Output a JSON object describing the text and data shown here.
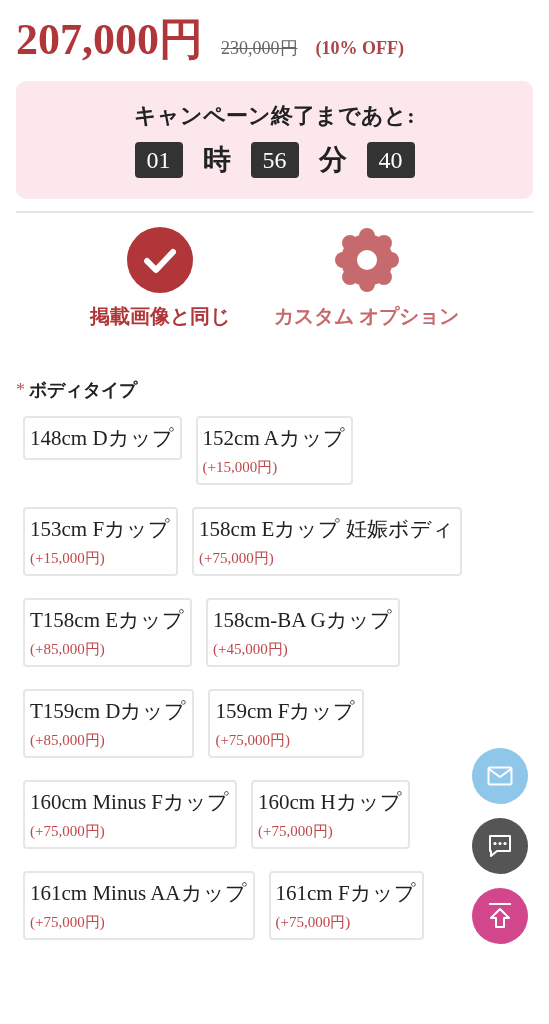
{
  "price": {
    "current": "207,000円",
    "original": "230,000円",
    "discount": "(10% OFF)"
  },
  "countdown": {
    "title": "キャンペーン終了まであと:",
    "segments": [
      {
        "kind": "number",
        "text": "01"
      },
      {
        "kind": "unit",
        "text": "時"
      },
      {
        "kind": "number",
        "text": "56"
      },
      {
        "kind": "unit",
        "text": "分"
      },
      {
        "kind": "number",
        "text": "40"
      }
    ]
  },
  "modes": [
    {
      "kind": "check",
      "label": "掲載画像と同じ",
      "selected": true
    },
    {
      "kind": "gear",
      "label": "カスタム オプション",
      "selected": false
    }
  ],
  "body_type": {
    "required_mark": "*",
    "title": "ボディタイプ",
    "options": [
      {
        "label": "148cm Dカップ"
      },
      {
        "label": "152cm Aカップ",
        "price": "(+15,000円)"
      },
      {
        "label": "153cm Fカップ",
        "price": "(+15,000円)"
      },
      {
        "label": "158cm Eカップ 妊娠ボディ",
        "price": "(+75,000円)"
      },
      {
        "label": "T158cm Eカップ",
        "price": "(+85,000円)"
      },
      {
        "label": "158cm-BA Gカップ",
        "price": "(+45,000円)"
      },
      {
        "label": "T159cm Dカップ",
        "price": "(+85,000円)"
      },
      {
        "label": "159cm Fカップ",
        "price": "(+75,000円)"
      },
      {
        "label": "160cm Minus Fカップ",
        "price": "(+75,000円)"
      },
      {
        "label": "160cm Hカップ",
        "price": "(+75,000円)"
      },
      {
        "label": "161cm Minus AAカップ",
        "price": "(+75,000円)"
      },
      {
        "label": "161cm Fカップ",
        "price": "(+75,000円)"
      }
    ]
  },
  "floating_buttons": [
    {
      "kind": "mail"
    },
    {
      "kind": "chat"
    },
    {
      "kind": "top"
    }
  ]
}
